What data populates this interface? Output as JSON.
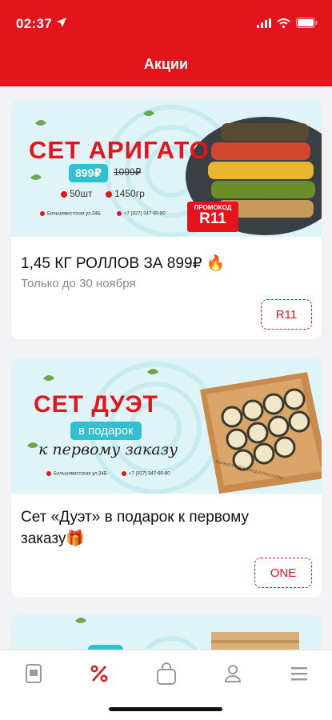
{
  "status_bar": {
    "time": "02:37"
  },
  "header": {
    "title": "Акции"
  },
  "promos": [
    {
      "banner": {
        "title": "СЕТ АРИГАТО",
        "price": "899₽",
        "old_price": "1099₽",
        "pieces": "50шт",
        "weight": "1450гр",
        "address": "Большевистская ул.34Б",
        "phone": "+7 (927) 347-90-80",
        "promo_caption": "ПРОМОКОД",
        "promo_code": "R11"
      },
      "title": "1,45 КГ РОЛЛОВ ЗА 899₽ 🔥",
      "subtitle": "Только до 30 ноября",
      "code_button": "R11"
    },
    {
      "banner": {
        "title": "СЕТ ДУЭТ",
        "pill": "в подарок",
        "script": "к первому заказу",
        "address": "Большевистская ул.34Б",
        "phone": "+7 (927) 347-90-80",
        "board_text": "УКАЖИТЕ ПРОМОКОД В РАССЫЛКЕ"
      },
      "title": "Сет «Дуэт» в подарок к первому заказу🎁",
      "code_button": "ONE"
    }
  ],
  "tabbar": {
    "items": [
      "menu-icon",
      "promo-icon",
      "cart-icon",
      "profile-icon",
      "more-icon"
    ],
    "active_color": "#e4141c",
    "inactive_color": "#9a9a9a",
    "active_index": 1
  },
  "colors": {
    "brand": "#e4141c",
    "accent": "#2fc0d2"
  }
}
